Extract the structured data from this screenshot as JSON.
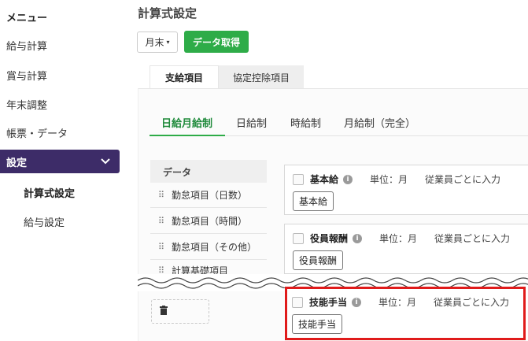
{
  "sidebar": {
    "title": "メニュー",
    "items": [
      {
        "label": "給与計算"
      },
      {
        "label": "賞与計算"
      },
      {
        "label": "年末調整"
      },
      {
        "label": "帳票・データ"
      }
    ],
    "active": {
      "label": "設定",
      "icon": "chevron-down-icon"
    },
    "sub_items": [
      {
        "label": "計算式設定"
      },
      {
        "label": "給与設定"
      }
    ]
  },
  "header": {
    "title": "計算式設定",
    "month_select": "月末",
    "fetch_button": "データ取得"
  },
  "tabs": [
    {
      "label": "支給項目"
    },
    {
      "label": "協定控除項目"
    }
  ],
  "subtabs": [
    {
      "label": "日給月給制"
    },
    {
      "label": "日給制"
    },
    {
      "label": "時給制"
    },
    {
      "label": "月給制（完全）"
    }
  ],
  "data_panel": {
    "header": "データ",
    "items": [
      {
        "label": "勤怠項目（日数）"
      },
      {
        "label": "勤怠項目（時間）"
      },
      {
        "label": "勤怠項目（その他）"
      },
      {
        "label": "計算基礎項目"
      }
    ]
  },
  "cards": [
    {
      "name": "基本給",
      "unit": "単位：月",
      "entry": "従業員ごとに入力",
      "tag": "基本給"
    },
    {
      "name": "役員報酬",
      "unit": "単位：月",
      "entry": "従業員ごとに入力",
      "tag": "役員報酬"
    },
    {
      "name": "技能手当",
      "unit": "単位：月",
      "entry": "従業員ごとに入力",
      "tag": "技能手当"
    }
  ],
  "colors": {
    "accent_green": "#2eac48",
    "sidebar_active": "#3d2c68",
    "highlight_red": "#e01b1b"
  }
}
